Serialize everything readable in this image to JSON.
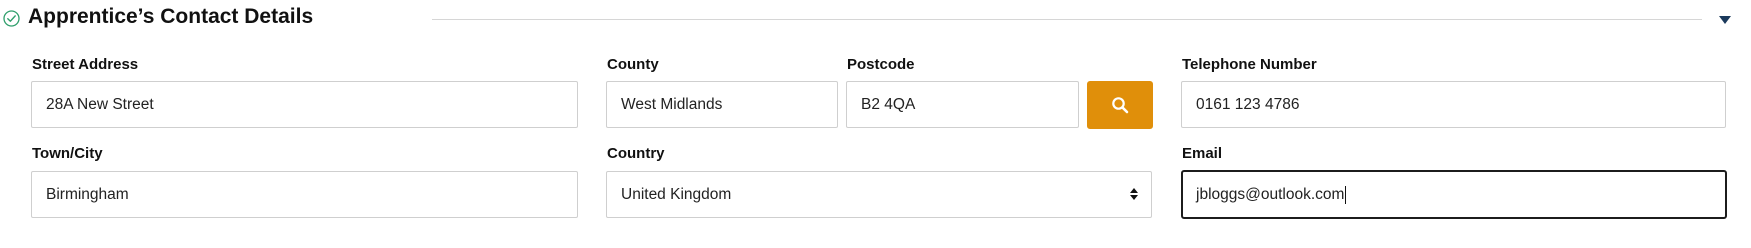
{
  "section": {
    "title": "Apprentice’s Contact Details",
    "status_icon": "check-circle-icon",
    "collapse_icon": "caret-down-icon",
    "colors": {
      "check": "#2e9e6b",
      "accent_button": "#e08f0a",
      "collapse": "#1b3a5c"
    }
  },
  "fields": {
    "street_address": {
      "label": "Street Address",
      "value": "28A New Street"
    },
    "county": {
      "label": "County",
      "value": "West Midlands"
    },
    "postcode": {
      "label": "Postcode",
      "value": "B2 4QA",
      "search_icon": "search-icon"
    },
    "telephone": {
      "label": "Telephone Number",
      "value": "0161 123 4786"
    },
    "town_city": {
      "label": "Town/City",
      "value": "Birmingham"
    },
    "country": {
      "label": "Country",
      "value": "United Kingdom"
    },
    "email": {
      "label": "Email",
      "value": "jbloggs@outlook.com"
    }
  }
}
